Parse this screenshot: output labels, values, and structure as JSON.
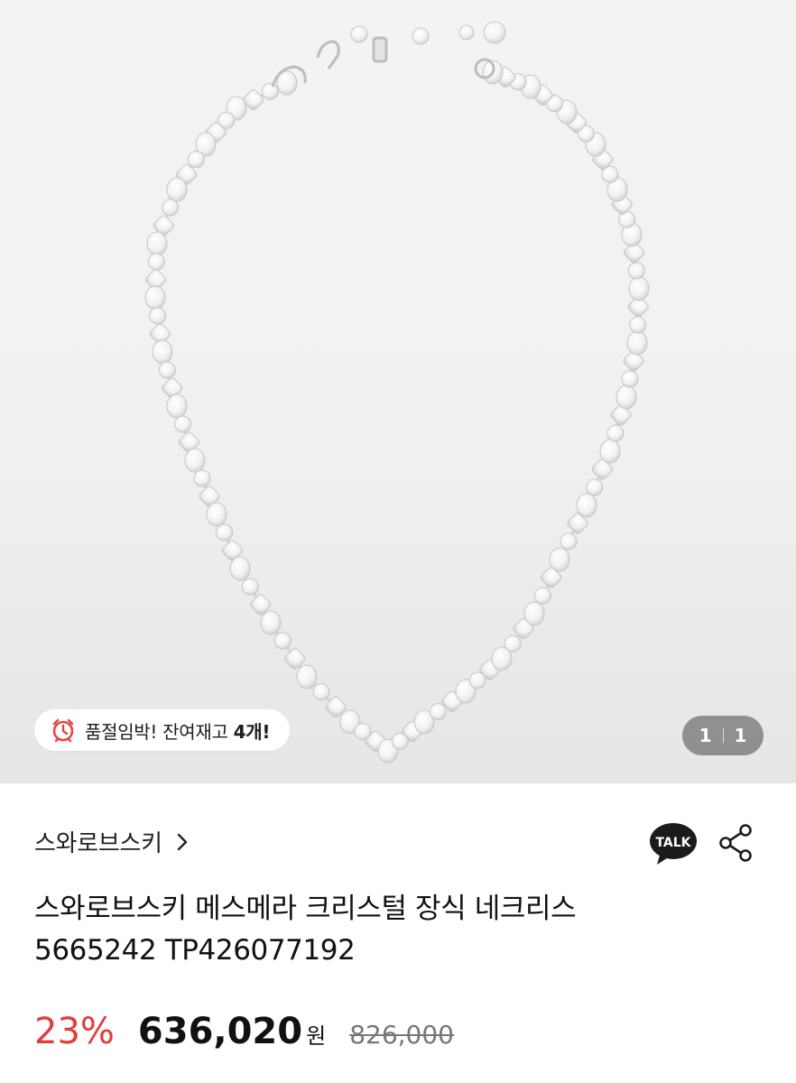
{
  "product_image": {
    "alt": "스와로브스키 메스메라 크리스털 장식 네크리스",
    "stock_badge": {
      "icon": "alarm-clock-icon",
      "prefix": "품절임박! 잔여재고 ",
      "count": "4개!"
    },
    "pager": {
      "current": "1",
      "total": "1"
    }
  },
  "brand": {
    "name": "스와로브스키"
  },
  "actions": {
    "talk_label": "TALK",
    "talk_icon": "kakao-talk-icon",
    "share_icon": "share-icon"
  },
  "product": {
    "title_line1": "스와로브스키 메스메라 크리스털 장식 네크리스",
    "title_line2": "5665242 TP426077192"
  },
  "price": {
    "discount": "23%",
    "sale": "636,020",
    "unit": "원",
    "original": "826,000"
  },
  "colors": {
    "discount": "#e23b3b",
    "hero_bg": "#f1f1f1"
  }
}
